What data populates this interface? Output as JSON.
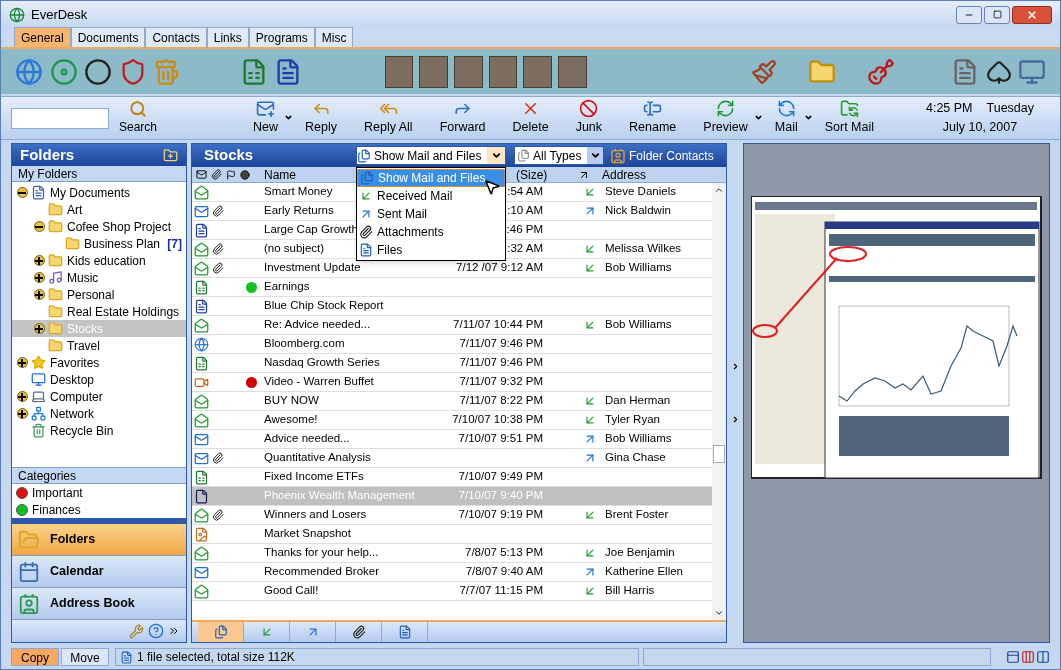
{
  "window": {
    "title": "EverDesk"
  },
  "tabs": [
    {
      "label": "General",
      "selected": true
    },
    {
      "label": "Documents",
      "selected": false
    },
    {
      "label": "Contacts",
      "selected": false
    },
    {
      "label": "Links",
      "selected": false
    },
    {
      "label": "Programs",
      "selected": false
    },
    {
      "label": "Misc",
      "selected": false
    }
  ],
  "toolbar": {
    "search_button": "Search",
    "buttons": [
      {
        "label": "New",
        "kind": "new",
        "menu": true
      },
      {
        "label": "Reply",
        "kind": "reply",
        "menu": false
      },
      {
        "label": "Reply All",
        "kind": "reply_all",
        "menu": false
      },
      {
        "label": "Forward",
        "kind": "forward",
        "menu": false
      },
      {
        "label": "Delete",
        "kind": "delete",
        "menu": false
      },
      {
        "label": "Junk",
        "kind": "junk",
        "menu": false
      },
      {
        "label": "Rename",
        "kind": "rename",
        "menu": false
      },
      {
        "label": "Preview",
        "kind": "preview",
        "menu": true
      },
      {
        "label": "Mail",
        "kind": "mail",
        "menu": true
      },
      {
        "label": "Sort Mail",
        "kind": "sort",
        "menu": false
      }
    ],
    "clock": {
      "time": "4:25 PM",
      "day": "Tuesday",
      "date": "July 10, 2007"
    }
  },
  "folders_panel": {
    "title": "Folders",
    "section": "My Folders",
    "tree": [
      {
        "label": "My Documents",
        "kind": "documents",
        "expandable": true,
        "expanded": true,
        "selected": false,
        "children": [
          {
            "label": "Art",
            "kind": "folder",
            "expandable": false,
            "selected": false
          },
          {
            "label": "Cofee Shop Project",
            "kind": "folder",
            "expandable": true,
            "expanded": true,
            "selected": false,
            "children": [
              {
                "label": "Business Plan",
                "kind": "folder",
                "expandable": false,
                "selected": false,
                "count": "[7]"
              }
            ]
          },
          {
            "label": "Kids education",
            "kind": "folder",
            "expandable": true,
            "expanded": false,
            "selected": false
          },
          {
            "label": "Music",
            "kind": "music",
            "expandable": true,
            "expanded": false,
            "selected": false
          },
          {
            "label": "Personal",
            "kind": "folder",
            "expandable": true,
            "expanded": false,
            "selected": false
          },
          {
            "label": "Real Estate Holdings",
            "kind": "folder",
            "expandable": false,
            "selected": false
          },
          {
            "label": "Stocks",
            "kind": "folder",
            "expandable": true,
            "expanded": false,
            "selected": true
          },
          {
            "label": "Travel",
            "kind": "folder",
            "expandable": false,
            "selected": false
          }
        ]
      },
      {
        "label": "Favorites",
        "kind": "star",
        "expandable": true,
        "expanded": false,
        "selected": false
      },
      {
        "label": "Desktop",
        "kind": "desktop",
        "expandable": false,
        "selected": false
      },
      {
        "label": "Computer",
        "kind": "computer",
        "expandable": true,
        "expanded": false,
        "selected": false
      },
      {
        "label": "Network",
        "kind": "network",
        "expandable": true,
        "expanded": false,
        "selected": false
      },
      {
        "label": "Recycle Bin",
        "kind": "recycle",
        "expandable": false,
        "selected": false
      }
    ],
    "categories_title": "Categories",
    "categories": [
      {
        "label": "Important",
        "color": "#e01010"
      },
      {
        "label": "Finances",
        "color": "#10c020"
      }
    ],
    "nav": [
      {
        "label": "Folders",
        "kind": "folders",
        "selected": true
      },
      {
        "label": "Calendar",
        "kind": "calendar",
        "selected": false
      },
      {
        "label": "Address Book",
        "kind": "address_book",
        "selected": false
      }
    ]
  },
  "list": {
    "title": "Stocks",
    "filter": {
      "value": "Show Mail and Files",
      "options": [
        {
          "label": "Show Mail and Files",
          "kind": "all",
          "selected": true
        },
        {
          "label": "Received Mail",
          "kind": "received",
          "selected": false
        },
        {
          "label": "Sent Mail",
          "kind": "sent",
          "selected": false
        },
        {
          "label": "Attachments",
          "kind": "attachments",
          "selected": false
        },
        {
          "label": "Files",
          "kind": "files",
          "selected": false
        }
      ]
    },
    "type_filter": {
      "value": "All Types"
    },
    "contacts_button": "Folder Contacts",
    "columns": {
      "name": "Name",
      "size": "(Size)",
      "address": "Address"
    },
    "rows": [
      {
        "kind": "mail_received",
        "attachment": false,
        "name": "Smart Money",
        "date": ":54 AM",
        "sent": false,
        "address": "Steve Daniels",
        "selected": false
      },
      {
        "kind": "mail_sent",
        "attachment": true,
        "name": "Early Returns",
        "date": ":10 AM",
        "sent": true,
        "address": "Nick Baldwin",
        "selected": false
      },
      {
        "kind": "word",
        "attachment": false,
        "name": "Large Cap Growth",
        "date": ":46 PM",
        "selected": false
      },
      {
        "kind": "mail_received",
        "attachment": true,
        "name": "(no subject)",
        "date": ":32 AM",
        "sent": false,
        "address": "Melissa Wilkes",
        "selected": false
      },
      {
        "kind": "mail_received",
        "attachment": true,
        "name": "Investment Update",
        "date": "7/12 /07 9:12 AM",
        "sent": false,
        "address": "Bob Williams",
        "selected": false
      },
      {
        "kind": "excel",
        "attachment": false,
        "color": "#10c020",
        "name": "Earnings",
        "selected": false
      },
      {
        "kind": "word",
        "attachment": false,
        "name": "Blue Chip Stock Report",
        "selected": false
      },
      {
        "kind": "mail_received",
        "attachment": false,
        "name": "Re: Advice needed...",
        "date": "7/11/07 10:44 PM",
        "sent": false,
        "address": "Bob Williams",
        "selected": false
      },
      {
        "kind": "ie",
        "attachment": false,
        "name": "Bloomberg.com",
        "date": "7/11/07 9:46 PM",
        "selected": false
      },
      {
        "kind": "excel",
        "attachment": false,
        "name": "Nasdaq Growth Series",
        "date": "7/11/07 9:46 PM",
        "selected": false
      },
      {
        "kind": "video",
        "attachment": false,
        "color": "#d00000",
        "name": "Video - Warren Buffet",
        "date": "7/11/07 9:32 PM",
        "selected": false
      },
      {
        "kind": "mail_received",
        "attachment": false,
        "name": "BUY NOW",
        "date": "7/11/07 8:22 PM",
        "sent": false,
        "address": "Dan Herman",
        "selected": false
      },
      {
        "kind": "mail_received",
        "attachment": false,
        "name": "Awesome!",
        "date": "7/10/07 10:38 PM",
        "sent": false,
        "address": "Tyler Ryan",
        "selected": false
      },
      {
        "kind": "mail_sent",
        "attachment": false,
        "name": "Advice needed...",
        "date": "7/10/07 9:51 PM",
        "sent": true,
        "address": "Bob Williams",
        "selected": false
      },
      {
        "kind": "mail_sent",
        "attachment": true,
        "name": "Quantitative Analysis",
        "sent": true,
        "address": "Gina Chase",
        "selected": false
      },
      {
        "kind": "excel",
        "attachment": false,
        "name": "Fixed Income ETFs",
        "date": "7/10/07 9:49 PM",
        "selected": false
      },
      {
        "kind": "document",
        "attachment": false,
        "name": "Phoenix Wealth Management",
        "date": "7/10/07 9:40 PM",
        "selected": true
      },
      {
        "kind": "mail_received",
        "attachment": true,
        "name": "Winners and Losers",
        "date": "7/10/07 9:19 PM",
        "sent": false,
        "address": "Brent Foster",
        "selected": false
      },
      {
        "kind": "image",
        "attachment": false,
        "name": "Market Snapshot",
        "selected": false
      },
      {
        "kind": "mail_received",
        "attachment": false,
        "name": "Thanks for your help...",
        "date": "7/8/07 5:13 PM",
        "sent": false,
        "address": "Joe Benjamin",
        "selected": false
      },
      {
        "kind": "mail_sent",
        "attachment": false,
        "name": "Recommended Broker",
        "date": "7/8/07 9:40 AM",
        "sent": true,
        "address": "Katherine Ellen",
        "selected": false
      },
      {
        "kind": "mail_received",
        "attachment": false,
        "name": "Good Call!",
        "date": "7/7/07 11:15 PM",
        "sent": false,
        "address": "Bill Harris",
        "selected": false
      }
    ],
    "tabs": [
      {
        "kind": "all",
        "selected": true
      },
      {
        "kind": "received",
        "selected": false
      },
      {
        "kind": "sent",
        "selected": false
      },
      {
        "kind": "attachments",
        "selected": false
      },
      {
        "kind": "files",
        "selected": false
      }
    ]
  },
  "status_bar": {
    "modes": [
      {
        "label": "Copy",
        "selected": true
      },
      {
        "label": "Move",
        "selected": false
      }
    ],
    "message": "1 file selected, total size 112K"
  }
}
